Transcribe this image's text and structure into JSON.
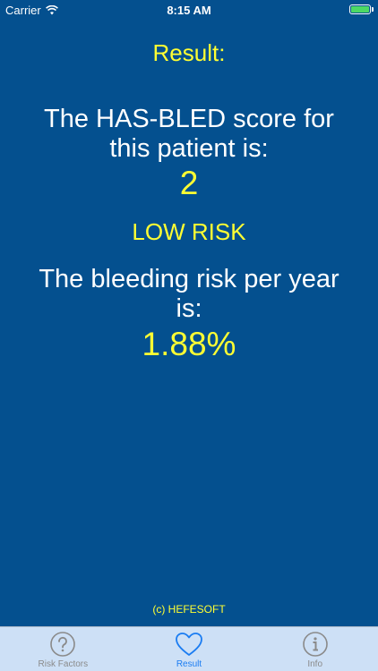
{
  "status_bar": {
    "carrier": "Carrier",
    "time": "8:15 AM"
  },
  "result": {
    "heading": "Result:",
    "score_label": "The HAS-BLED score for this patient is:",
    "score_value": "2",
    "risk_level": "LOW RISK",
    "bleeding_label": "The bleeding risk per year is:",
    "bleeding_value": "1.88%"
  },
  "footer": {
    "copyright": "(c) HEFESOFT"
  },
  "tabs": [
    {
      "label": "Risk Factors",
      "icon": "question-circle-icon",
      "active": false
    },
    {
      "label": "Result",
      "icon": "heart-icon",
      "active": true
    },
    {
      "label": "Info",
      "icon": "info-circle-icon",
      "active": false
    }
  ],
  "colors": {
    "background": "#04508f",
    "highlight": "#ffff33",
    "tab_active": "#1a7cf2",
    "tab_inactive": "#8a8a8a"
  }
}
